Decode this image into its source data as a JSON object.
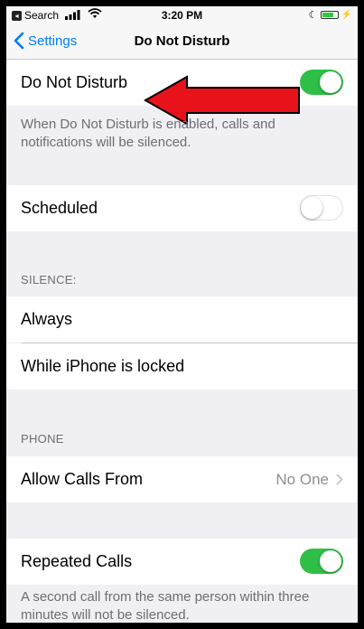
{
  "status_bar": {
    "back_app": "Search",
    "time": "3:20 PM"
  },
  "nav": {
    "back_label": "Settings",
    "title": "Do Not Disturb"
  },
  "dnd": {
    "label": "Do Not Disturb",
    "enabled": true,
    "footnote": "When Do Not Disturb is enabled, calls and notifications will be silenced."
  },
  "scheduled": {
    "label": "Scheduled",
    "enabled": false
  },
  "silence": {
    "header": "SILENCE:",
    "options": [
      "Always",
      "While iPhone is locked"
    ]
  },
  "phone": {
    "header": "PHONE",
    "allow_calls_label": "Allow Calls From",
    "allow_calls_value": "No One"
  },
  "repeated_calls": {
    "label": "Repeated Calls",
    "enabled": true,
    "footnote": "A second call from the same person within three minutes will not be silenced."
  },
  "colors": {
    "accent": "#007aff",
    "toggle_on": "#2fbf47",
    "annotation_arrow": "#e8121a"
  }
}
